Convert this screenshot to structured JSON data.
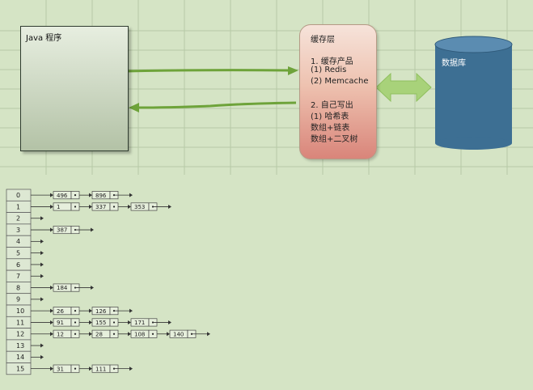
{
  "java_box": {
    "label": "Java 程序"
  },
  "cache_box": {
    "lines": [
      "缓存层",
      "1. 缓存产品",
      "(1) Redis",
      "(2) Memcache",
      "2. 自己写出",
      "(1) 哈希表",
      "数组+链表",
      "数组+二叉树"
    ]
  },
  "database": {
    "label": "数据库"
  },
  "hash_table": {
    "indices": [
      "0",
      "1",
      "2",
      "3",
      "4",
      "5",
      "6",
      "7",
      "8",
      "9",
      "10",
      "11",
      "12",
      "13",
      "14",
      "15"
    ],
    "chains": [
      [
        "496",
        "896"
      ],
      [
        "1",
        "337",
        "353"
      ],
      [],
      [
        "387"
      ],
      [],
      [],
      [],
      [],
      [
        "184"
      ],
      [],
      [
        "26",
        "126"
      ],
      [
        "91",
        "155",
        "171"
      ],
      [
        "12",
        "28",
        "108",
        "140"
      ],
      [],
      [],
      [
        "31",
        "111"
      ]
    ]
  },
  "colors": {
    "background": "#d5e4c5",
    "grid_line": "#b7c9a7",
    "arrow_green": "#6ea33a",
    "db_blue": "#3d6f93",
    "db_top": "#5b8cb1",
    "double_arrow": "#a8d27a"
  },
  "icons": [
    "right-arrow-icon",
    "left-arrow-icon",
    "double-arrow-icon",
    "database-cylinder-icon"
  ]
}
